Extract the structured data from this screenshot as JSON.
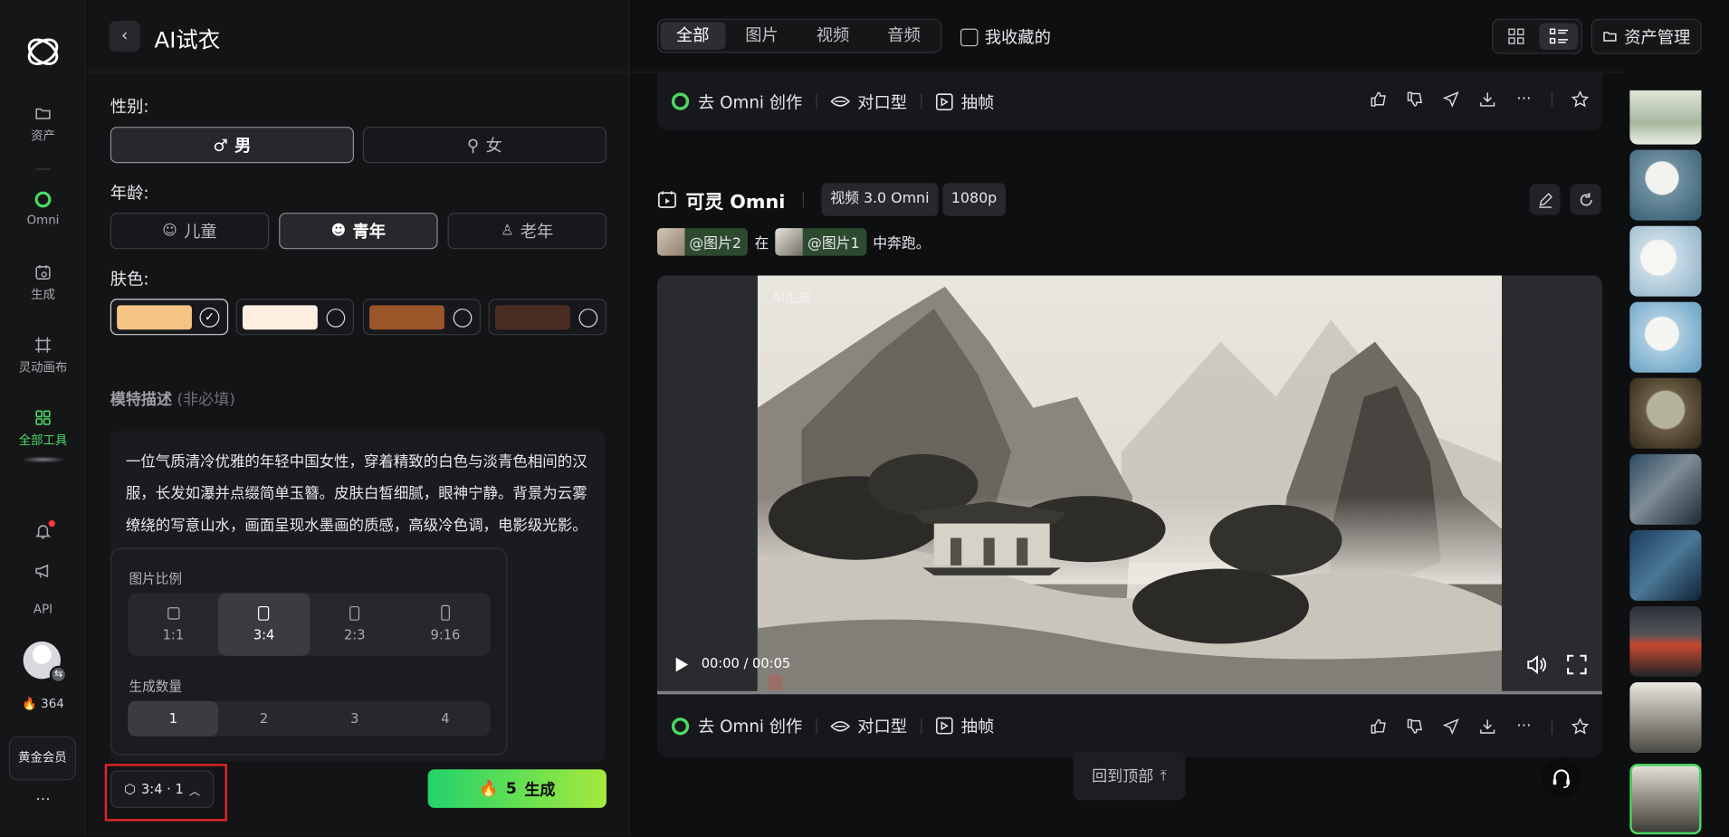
{
  "nav": {
    "items": [
      {
        "label": "资产"
      },
      {
        "label": "Omni"
      },
      {
        "label": "生成"
      },
      {
        "label": "灵动画布"
      },
      {
        "label": "全部工具"
      }
    ],
    "api_label": "API",
    "credits": "364",
    "member_label": "黄金会员",
    "more": "···"
  },
  "panel": {
    "title": "AI试衣",
    "gender_label": "性别:",
    "gender_options": [
      "男",
      "女"
    ],
    "gender_selected": "男",
    "age_label": "年龄:",
    "age_options": [
      "儿童",
      "青年",
      "老年"
    ],
    "age_selected": "青年",
    "skin_label": "肤色:",
    "skin_colors": [
      "#f7c384",
      "#fdeee2",
      "#9a5529",
      "#4a2d22"
    ],
    "skin_selected_index": 0,
    "model_desc_label": "模特描述",
    "model_desc_optional": "(非必填)",
    "model_desc_text": "一位气质清冷优雅的年轻中国女性，穿着精致的白色与淡青色相间的汉服，长发如瀑并点缀简单玉簪。皮肤白皙细腻，眼神宁静。背景为云雾缭绕的写意山水，画面呈现水墨画的质感，高级冷色调，电影级光影。",
    "ratio_label": "图片比例",
    "ratios": [
      "1:1",
      "3:4",
      "2:3",
      "9:16"
    ],
    "ratio_selected": "3:4",
    "count_label": "生成数量",
    "counts": [
      "1",
      "2",
      "3",
      "4"
    ],
    "count_selected": "1",
    "settings_summary": "3:4 · 1",
    "generate_cost": "5",
    "generate_label": "生成"
  },
  "main": {
    "tabs": [
      "全部",
      "图片",
      "视频",
      "音频"
    ],
    "tab_selected": "全部",
    "favorites_label": "我收藏的",
    "asset_mgmt_label": "资产管理",
    "actions": {
      "omni": "去 Omni 创作",
      "lipsync": "对口型",
      "frames": "抽帧"
    },
    "card": {
      "model_name": "可灵 Omni",
      "tags": [
        "视频 3.0 Omni",
        "1080p"
      ],
      "prompt_ref2": "@图片2",
      "prompt_mid": "在",
      "prompt_ref1": "@图片1",
      "prompt_end": "中奔跑。",
      "watermark": "AI生成",
      "time": "00:00 / 00:05",
      "progress": 0
    },
    "back_to_top": "回到顶部"
  },
  "colors": {
    "accent_green": "#4cd964",
    "generate_gradient_start": "#22d36a",
    "generate_gradient_end": "#a4ea3c",
    "highlight_red": "#e0242a"
  }
}
